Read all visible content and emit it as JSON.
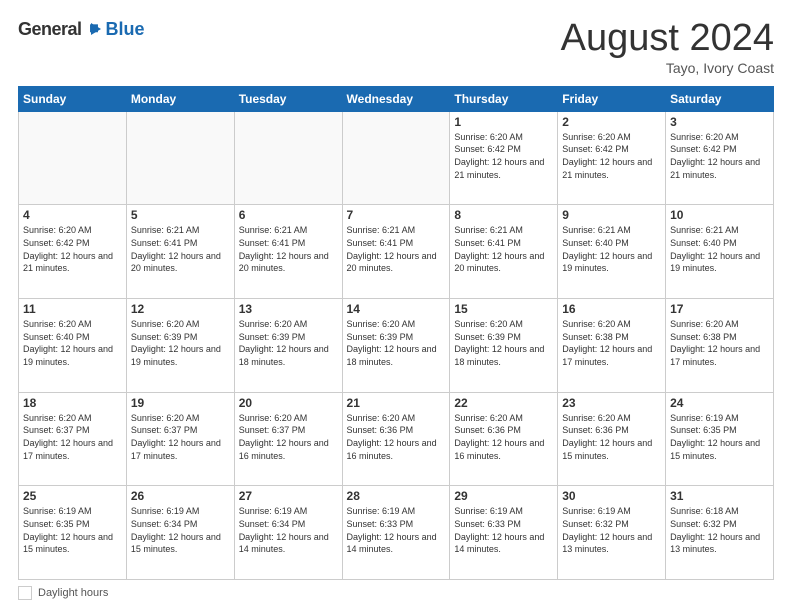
{
  "logo": {
    "general": "General",
    "blue": "Blue",
    "icon": "▶"
  },
  "title": "August 2024",
  "location": "Tayo, Ivory Coast",
  "footer": {
    "daylight_label": "Daylight hours"
  },
  "days_of_week": [
    "Sunday",
    "Monday",
    "Tuesday",
    "Wednesday",
    "Thursday",
    "Friday",
    "Saturday"
  ],
  "weeks": [
    [
      {
        "day": "",
        "info": ""
      },
      {
        "day": "",
        "info": ""
      },
      {
        "day": "",
        "info": ""
      },
      {
        "day": "",
        "info": ""
      },
      {
        "day": "1",
        "info": "Sunrise: 6:20 AM\nSunset: 6:42 PM\nDaylight: 12 hours\nand 21 minutes."
      },
      {
        "day": "2",
        "info": "Sunrise: 6:20 AM\nSunset: 6:42 PM\nDaylight: 12 hours\nand 21 minutes."
      },
      {
        "day": "3",
        "info": "Sunrise: 6:20 AM\nSunset: 6:42 PM\nDaylight: 12 hours\nand 21 minutes."
      }
    ],
    [
      {
        "day": "4",
        "info": "Sunrise: 6:20 AM\nSunset: 6:42 PM\nDaylight: 12 hours\nand 21 minutes."
      },
      {
        "day": "5",
        "info": "Sunrise: 6:21 AM\nSunset: 6:41 PM\nDaylight: 12 hours\nand 20 minutes."
      },
      {
        "day": "6",
        "info": "Sunrise: 6:21 AM\nSunset: 6:41 PM\nDaylight: 12 hours\nand 20 minutes."
      },
      {
        "day": "7",
        "info": "Sunrise: 6:21 AM\nSunset: 6:41 PM\nDaylight: 12 hours\nand 20 minutes."
      },
      {
        "day": "8",
        "info": "Sunrise: 6:21 AM\nSunset: 6:41 PM\nDaylight: 12 hours\nand 20 minutes."
      },
      {
        "day": "9",
        "info": "Sunrise: 6:21 AM\nSunset: 6:40 PM\nDaylight: 12 hours\nand 19 minutes."
      },
      {
        "day": "10",
        "info": "Sunrise: 6:21 AM\nSunset: 6:40 PM\nDaylight: 12 hours\nand 19 minutes."
      }
    ],
    [
      {
        "day": "11",
        "info": "Sunrise: 6:20 AM\nSunset: 6:40 PM\nDaylight: 12 hours\nand 19 minutes."
      },
      {
        "day": "12",
        "info": "Sunrise: 6:20 AM\nSunset: 6:39 PM\nDaylight: 12 hours\nand 19 minutes."
      },
      {
        "day": "13",
        "info": "Sunrise: 6:20 AM\nSunset: 6:39 PM\nDaylight: 12 hours\nand 18 minutes."
      },
      {
        "day": "14",
        "info": "Sunrise: 6:20 AM\nSunset: 6:39 PM\nDaylight: 12 hours\nand 18 minutes."
      },
      {
        "day": "15",
        "info": "Sunrise: 6:20 AM\nSunset: 6:39 PM\nDaylight: 12 hours\nand 18 minutes."
      },
      {
        "day": "16",
        "info": "Sunrise: 6:20 AM\nSunset: 6:38 PM\nDaylight: 12 hours\nand 17 minutes."
      },
      {
        "day": "17",
        "info": "Sunrise: 6:20 AM\nSunset: 6:38 PM\nDaylight: 12 hours\nand 17 minutes."
      }
    ],
    [
      {
        "day": "18",
        "info": "Sunrise: 6:20 AM\nSunset: 6:37 PM\nDaylight: 12 hours\nand 17 minutes."
      },
      {
        "day": "19",
        "info": "Sunrise: 6:20 AM\nSunset: 6:37 PM\nDaylight: 12 hours\nand 17 minutes."
      },
      {
        "day": "20",
        "info": "Sunrise: 6:20 AM\nSunset: 6:37 PM\nDaylight: 12 hours\nand 16 minutes."
      },
      {
        "day": "21",
        "info": "Sunrise: 6:20 AM\nSunset: 6:36 PM\nDaylight: 12 hours\nand 16 minutes."
      },
      {
        "day": "22",
        "info": "Sunrise: 6:20 AM\nSunset: 6:36 PM\nDaylight: 12 hours\nand 16 minutes."
      },
      {
        "day": "23",
        "info": "Sunrise: 6:20 AM\nSunset: 6:36 PM\nDaylight: 12 hours\nand 15 minutes."
      },
      {
        "day": "24",
        "info": "Sunrise: 6:19 AM\nSunset: 6:35 PM\nDaylight: 12 hours\nand 15 minutes."
      }
    ],
    [
      {
        "day": "25",
        "info": "Sunrise: 6:19 AM\nSunset: 6:35 PM\nDaylight: 12 hours\nand 15 minutes."
      },
      {
        "day": "26",
        "info": "Sunrise: 6:19 AM\nSunset: 6:34 PM\nDaylight: 12 hours\nand 15 minutes."
      },
      {
        "day": "27",
        "info": "Sunrise: 6:19 AM\nSunset: 6:34 PM\nDaylight: 12 hours\nand 14 minutes."
      },
      {
        "day": "28",
        "info": "Sunrise: 6:19 AM\nSunset: 6:33 PM\nDaylight: 12 hours\nand 14 minutes."
      },
      {
        "day": "29",
        "info": "Sunrise: 6:19 AM\nSunset: 6:33 PM\nDaylight: 12 hours\nand 14 minutes."
      },
      {
        "day": "30",
        "info": "Sunrise: 6:19 AM\nSunset: 6:32 PM\nDaylight: 12 hours\nand 13 minutes."
      },
      {
        "day": "31",
        "info": "Sunrise: 6:18 AM\nSunset: 6:32 PM\nDaylight: 12 hours\nand 13 minutes."
      }
    ]
  ]
}
